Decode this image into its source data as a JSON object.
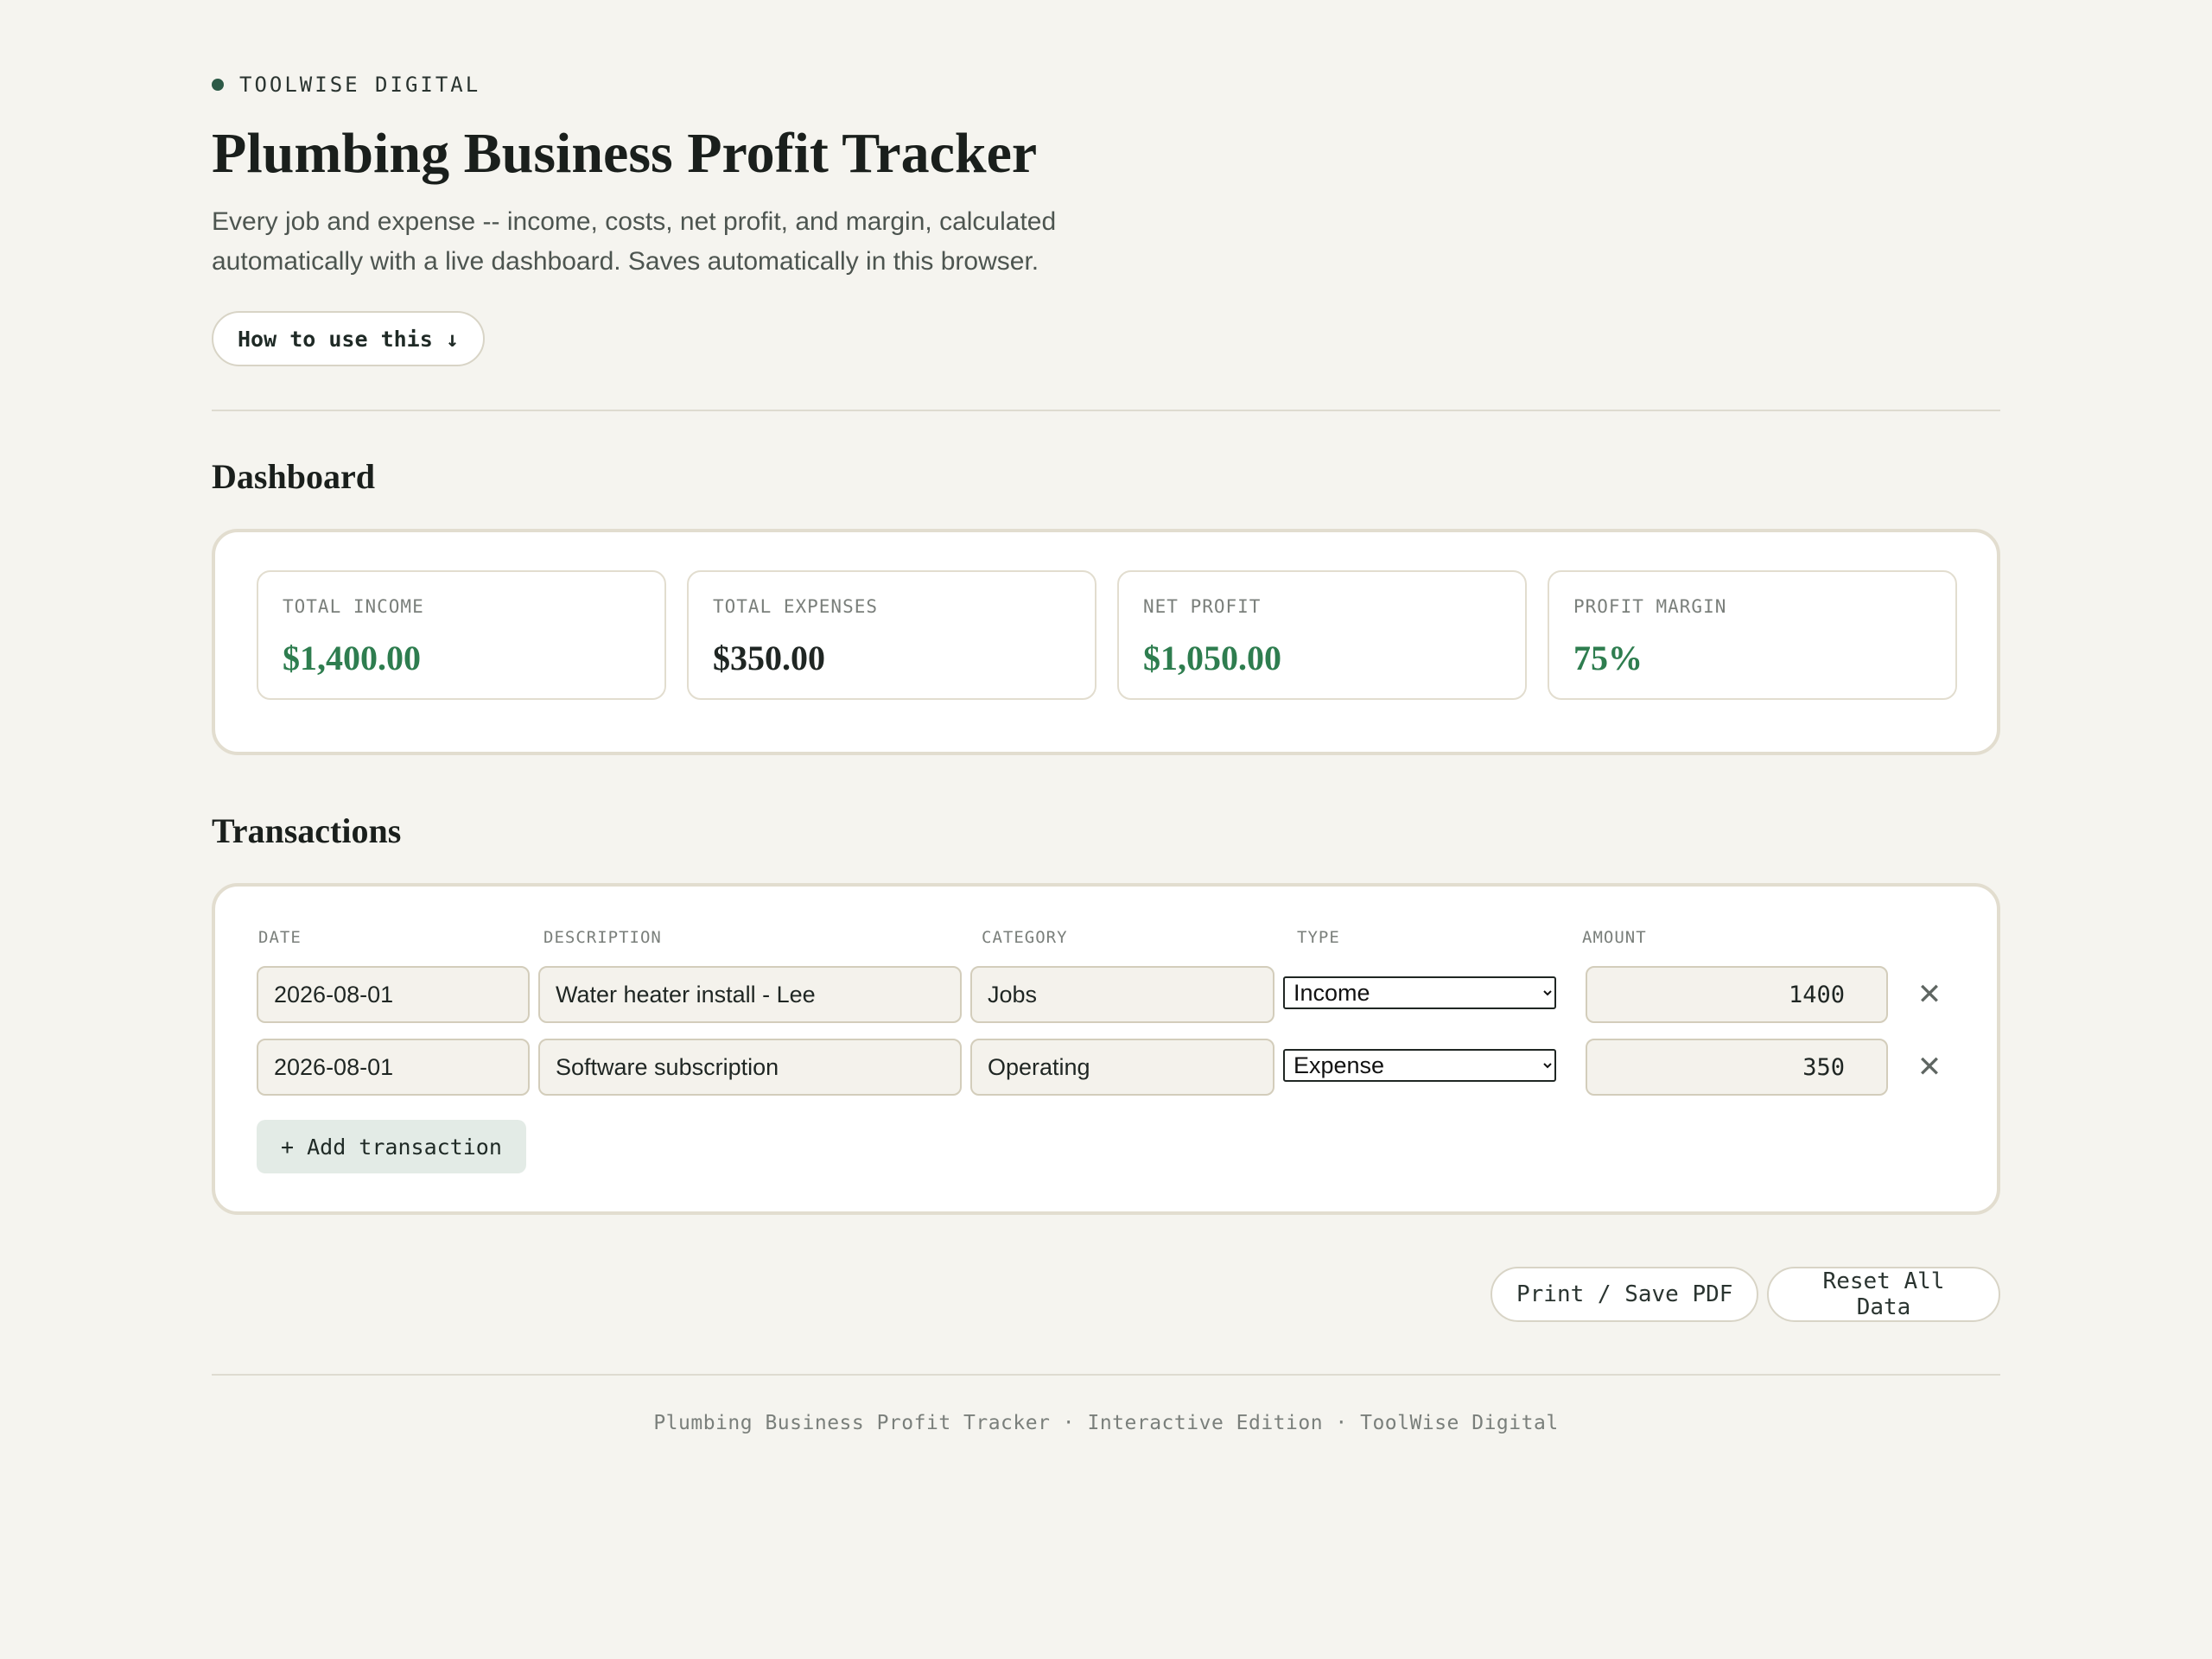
{
  "header": {
    "brand": "TOOLWISE DIGITAL",
    "title": "Plumbing Business Profit Tracker",
    "subtitle": "Every job and expense -- income, costs, net profit, and margin, calculated automatically with a live dashboard. Saves automatically in this browser.",
    "howto_label": "How to use this ↓"
  },
  "dashboard": {
    "title": "Dashboard",
    "stats": [
      {
        "label": "TOTAL INCOME",
        "value": "$1,400.00",
        "color": "#2e7d4f"
      },
      {
        "label": "TOTAL EXPENSES",
        "value": "$350.00",
        "color": "#1f2623"
      },
      {
        "label": "NET PROFIT",
        "value": "$1,050.00",
        "color": "#2e7d4f"
      },
      {
        "label": "PROFIT MARGIN",
        "value": "75%",
        "color": "#2e7d4f"
      }
    ]
  },
  "transactions": {
    "title": "Transactions",
    "columns": {
      "date": "DATE",
      "description": "DESCRIPTION",
      "category": "CATEGORY",
      "type": "TYPE",
      "amount": "AMOUNT"
    },
    "rows": [
      {
        "date": "2026-08-01",
        "description": "Water heater install - Lee",
        "category": "Jobs",
        "type": "Income",
        "amount": "1400"
      },
      {
        "date": "2026-08-01",
        "description": "Software subscription",
        "category": "Operating",
        "type": "Expense",
        "amount": "350"
      }
    ],
    "remove_icon": "close-icon",
    "remove_glyph": "✕",
    "add_label": "+ Add transaction"
  },
  "actions": {
    "print_label": "Print / Save PDF",
    "reset_label": "Reset All Data"
  },
  "footer": {
    "text": "Plumbing Business Profit Tracker · Interactive Edition · ToolWise Digital"
  }
}
